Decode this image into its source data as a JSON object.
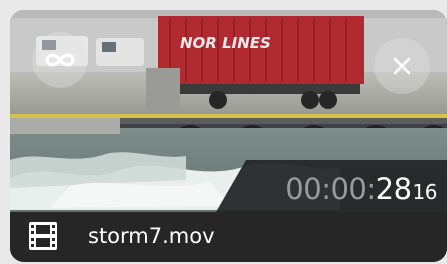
{
  "clip": {
    "timecode": {
      "prefix": "00:00:",
      "seconds": "28",
      "frames": "16"
    },
    "filename": "storm7.mov",
    "container_text": "NOR LINES"
  },
  "icons": {
    "loop": "loop-icon",
    "close": "close-icon",
    "film": "film-icon"
  },
  "colors": {
    "overlay_button": "#e1e1e1",
    "timecode_dim": "#9a9a9a",
    "timecode_bright": "#ffffff",
    "footer_bg": "#262626",
    "container_red": "#b02a2f"
  }
}
